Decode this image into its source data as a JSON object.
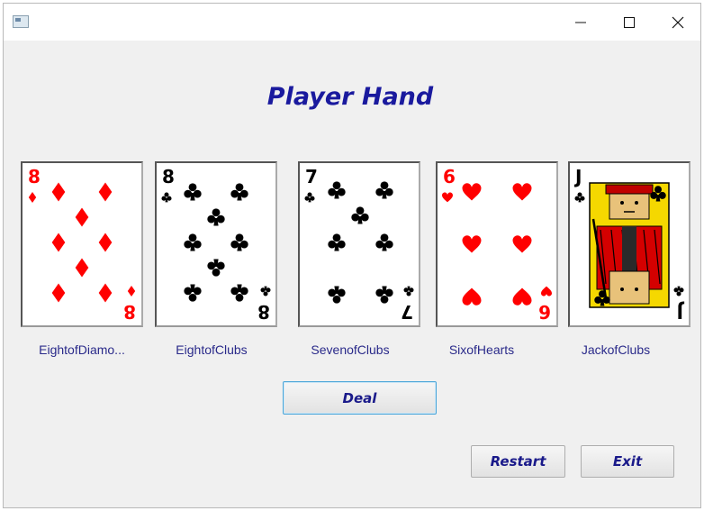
{
  "window": {
    "minimize_icon": "minimize-icon",
    "maximize_icon": "maximize-icon",
    "close_icon": "close-icon"
  },
  "title": "Player Hand",
  "cards": [
    {
      "label": "EightofDiamo...",
      "rank": "8",
      "suit": "diamonds",
      "color": "#ff0000"
    },
    {
      "label": "EightofClubs",
      "rank": "8",
      "suit": "clubs",
      "color": "#000000"
    },
    {
      "label": "SevenofClubs",
      "rank": "7",
      "suit": "clubs",
      "color": "#000000"
    },
    {
      "label": "SixofHearts",
      "rank": "6",
      "suit": "hearts",
      "color": "#ff0000"
    },
    {
      "label": "JackofClubs",
      "rank": "J",
      "suit": "clubs",
      "color": "#000000"
    }
  ],
  "buttons": {
    "deal": "Deal",
    "restart": "Restart",
    "exit": "Exit"
  },
  "colors": {
    "title": "#1a1a9e",
    "label": "#2a2a8a",
    "deal_border": "#4aa5d8"
  }
}
